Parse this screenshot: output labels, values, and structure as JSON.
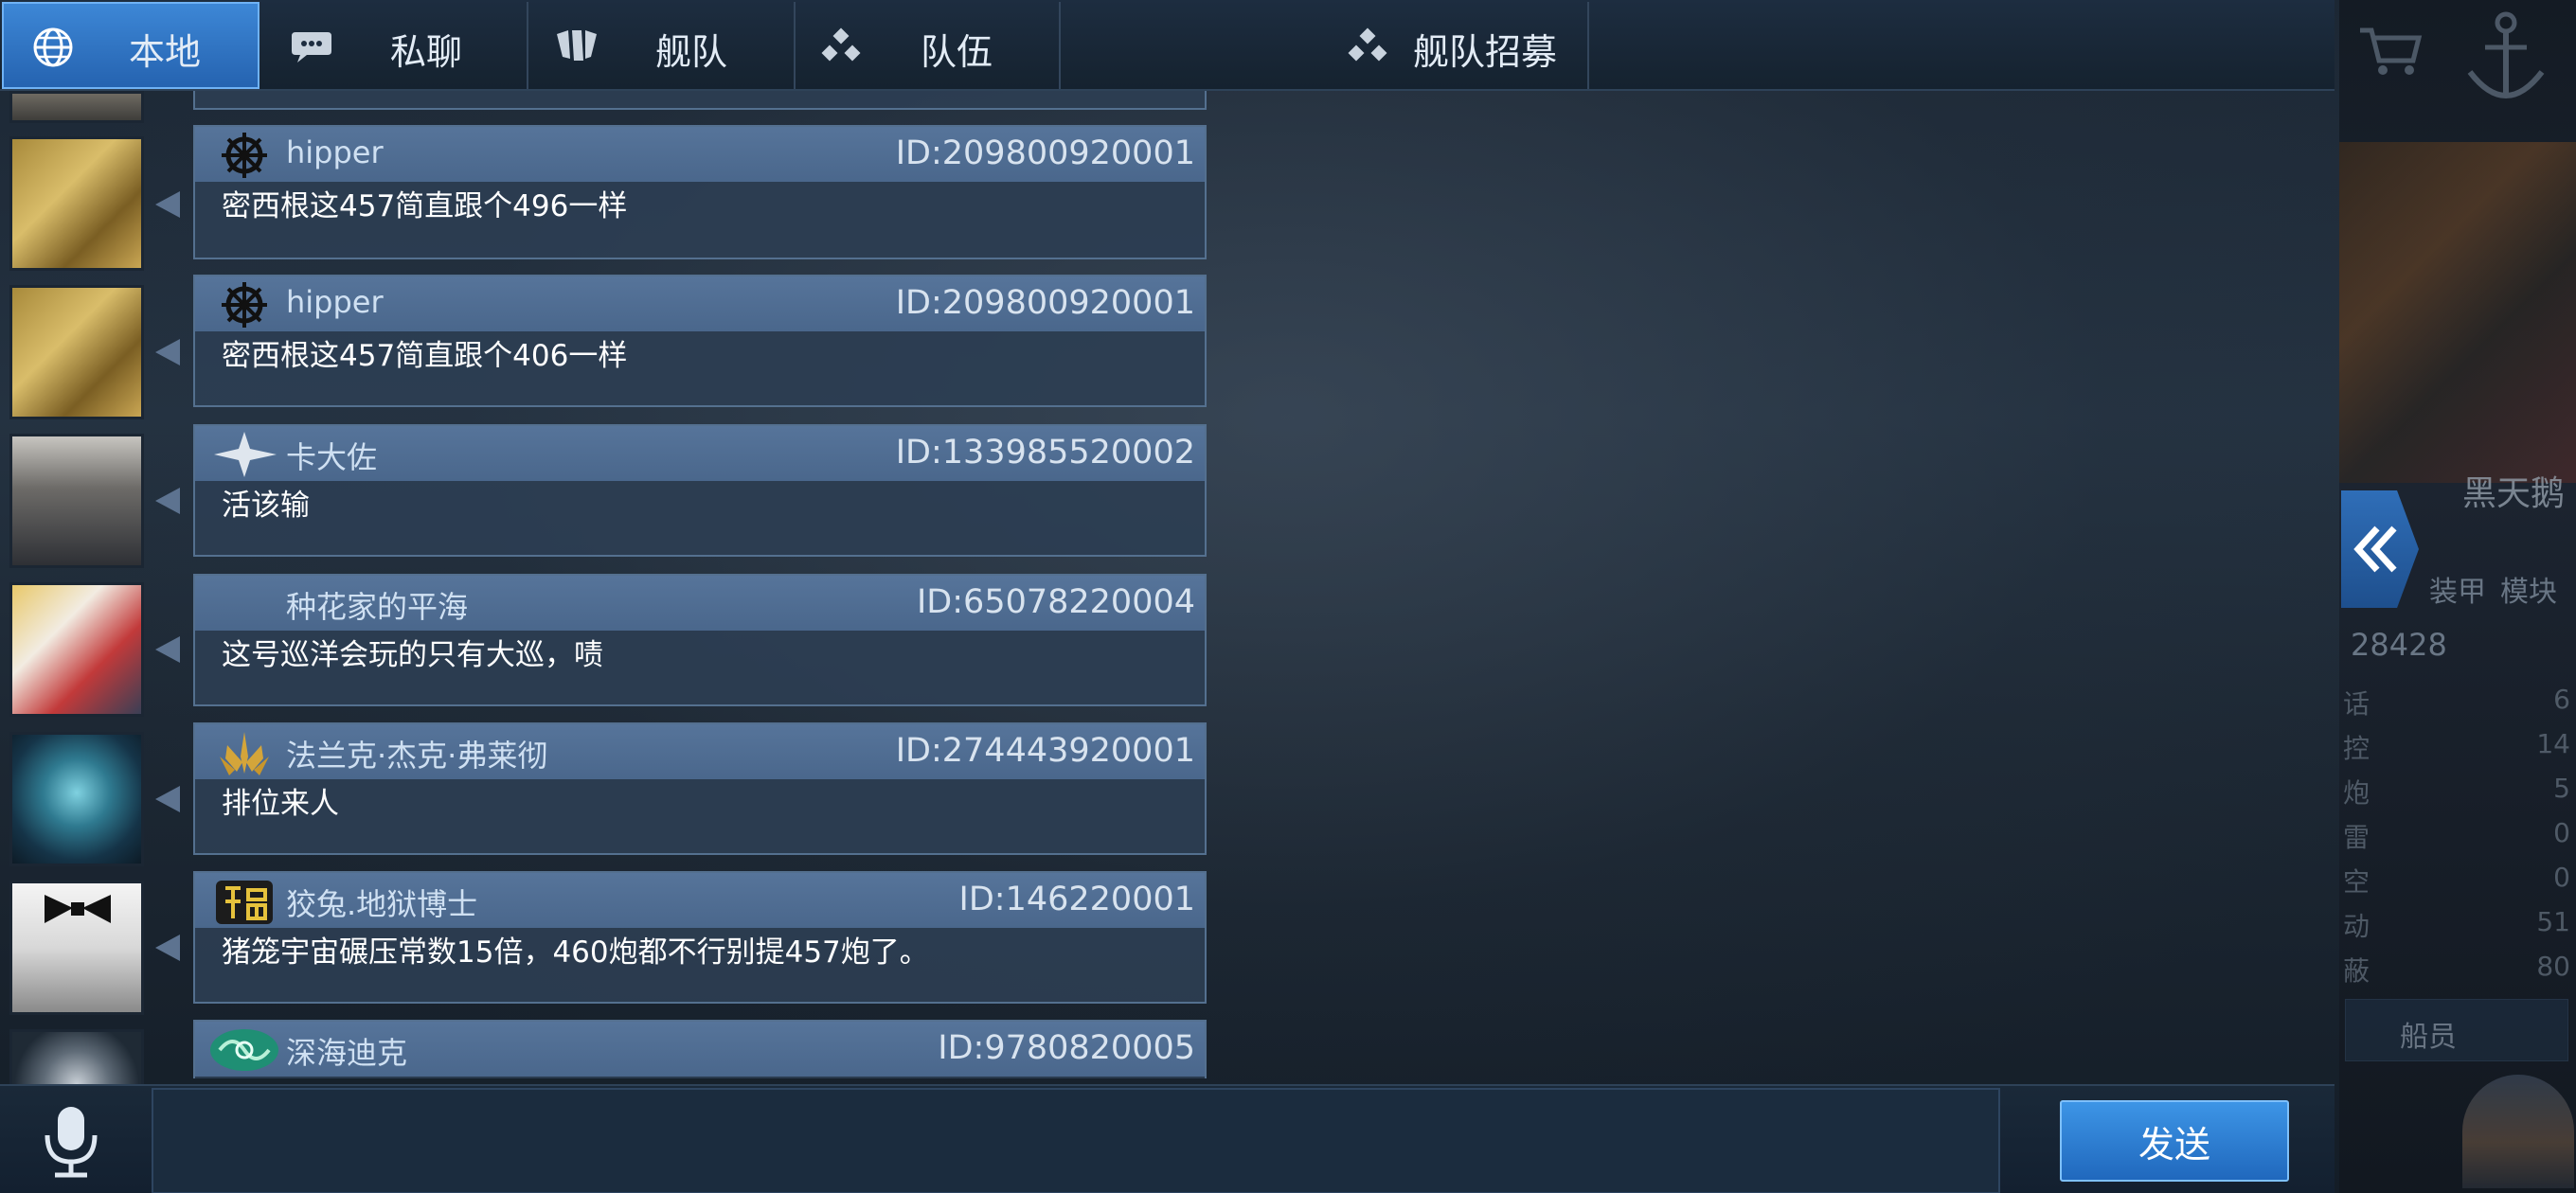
{
  "tabs": [
    {
      "label": "本地",
      "icon": "globe-icon",
      "active": true
    },
    {
      "label": "私聊",
      "icon": "chat-bubble-icon",
      "active": false
    },
    {
      "label": "舰队",
      "icon": "fleet-emblem-icon",
      "active": false
    },
    {
      "label": "队伍",
      "icon": "team-dots-icon",
      "active": false
    },
    {
      "label": "舰队招募",
      "icon": "recruit-dots-icon",
      "active": false
    }
  ],
  "messages": [
    {
      "name": "hipper",
      "id": "ID:209800920001",
      "text": "密西根这457简直跟个496一样",
      "badge": "ship-wheel-icon"
    },
    {
      "name": "hipper",
      "id": "ID:209800920001",
      "text": "密西根这457简直跟个406一样",
      "badge": "ship-wheel-icon"
    },
    {
      "name": "卡大佐",
      "id": "ID:133985520002",
      "text": "活该输",
      "badge": "star-rank-icon"
    },
    {
      "name": "种花家的平海",
      "id": "ID:65078220004",
      "text": "这号巡洋会玩的只有大巡，啧",
      "badge": ""
    },
    {
      "name": "法兰克·杰克·弗莱彻",
      "id": "ID:274443920001",
      "text": "排位来人",
      "badge": "gold-laurel-icon"
    },
    {
      "name": "狡兔.地狱博士",
      "id": "ID:146220001",
      "text": "猪笼宇宙碾压常数15倍，460炮都不行别提457炮了。",
      "badge": "fu-badge-icon"
    },
    {
      "name": "深海迪克",
      "id": "ID:9780820005",
      "text": "",
      "badge": "deep-sea-icon"
    }
  ],
  "input": {
    "placeholder": "",
    "value": ""
  },
  "send_label": "发送",
  "side_panel": {
    "ship_name": "黑天鹅",
    "armor_label": "装甲",
    "module_label": "模块",
    "power_value": "28428",
    "stats": [
      {
        "label": "话",
        "value": "6"
      },
      {
        "label": "控",
        "value": "14"
      },
      {
        "label": "炮",
        "value": "5"
      },
      {
        "label": "雷",
        "value": "0"
      },
      {
        "label": "空",
        "value": "0"
      },
      {
        "label": "动",
        "value": "51"
      },
      {
        "label": "蔽",
        "value": "80"
      }
    ],
    "crew_label": "船员"
  },
  "colors": {
    "active_tab": "#2f74c6",
    "message_header": "#4e6b91",
    "message_body": "#2d3e52",
    "send_button": "#2f80d6"
  }
}
